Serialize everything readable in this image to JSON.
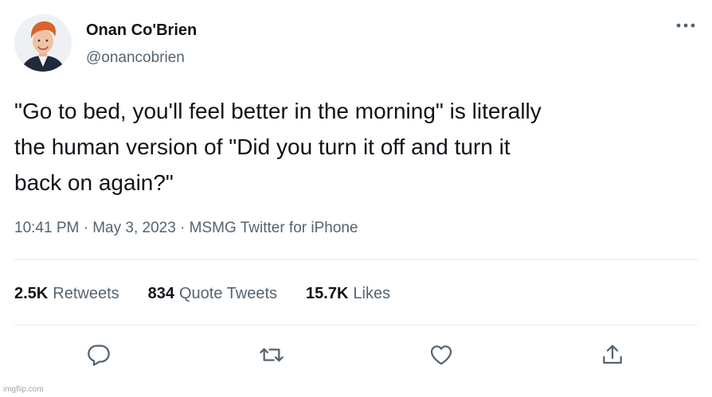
{
  "user": {
    "name": "Onan Co'Brien",
    "handle": "@onancobrien",
    "avatar_icon": "profile-photo"
  },
  "tweet": {
    "text": "\"Go to bed, you'll feel better in the morning\" is literally\nthe human version of \"Did you turn it off and turn it\nback on again?\"",
    "meta": "10:41 PM · May 3, 2023 · MSMG Twitter for iPhone"
  },
  "stats": {
    "retweets": {
      "count": "2.5K",
      "label": "Retweets"
    },
    "quotes": {
      "count": "834",
      "label": "Quote Tweets"
    },
    "likes": {
      "count": "15.7K",
      "label": "Likes"
    }
  },
  "actions": {
    "reply_icon": "reply-icon",
    "retweet_icon": "retweet-icon",
    "like_icon": "heart-icon",
    "share_icon": "share-icon"
  },
  "more_icon": "more-options-icon",
  "watermark": "imgflip.com",
  "colors": {
    "text": "#0f1419",
    "secondary": "#536471",
    "icon": "#536471",
    "divider": "#e6ecf0"
  }
}
